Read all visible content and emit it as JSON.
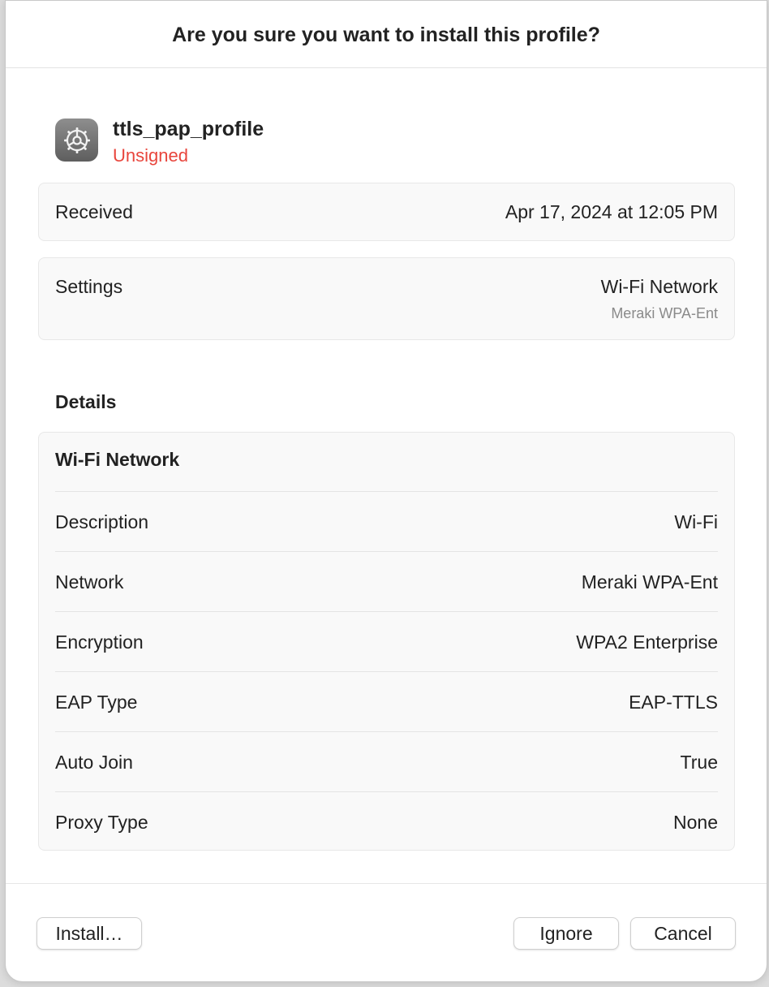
{
  "dialog": {
    "title": "Are you sure you want to install this profile?"
  },
  "profile": {
    "icon": "settings-gear-icon",
    "name": "ttls_pap_profile",
    "status": "Unsigned",
    "status_color": "#e8453c"
  },
  "summary": {
    "received_label": "Received",
    "received_value": "Apr 17, 2024 at 12:05 PM",
    "settings_label": "Settings",
    "settings_value": "Wi-Fi Network",
    "settings_subvalue": "Meraki WPA-Ent"
  },
  "details": {
    "heading": "Details",
    "section_title": "Wi-Fi Network",
    "rows": [
      {
        "label": "Description",
        "value": "Wi-Fi"
      },
      {
        "label": "Network",
        "value": "Meraki WPA-Ent"
      },
      {
        "label": "Encryption",
        "value": "WPA2 Enterprise"
      },
      {
        "label": "EAP Type",
        "value": "EAP-TTLS"
      },
      {
        "label": "Auto Join",
        "value": "True"
      },
      {
        "label": "Proxy Type",
        "value": "None"
      }
    ]
  },
  "buttons": {
    "install": "Install…",
    "ignore": "Ignore",
    "cancel": "Cancel"
  }
}
